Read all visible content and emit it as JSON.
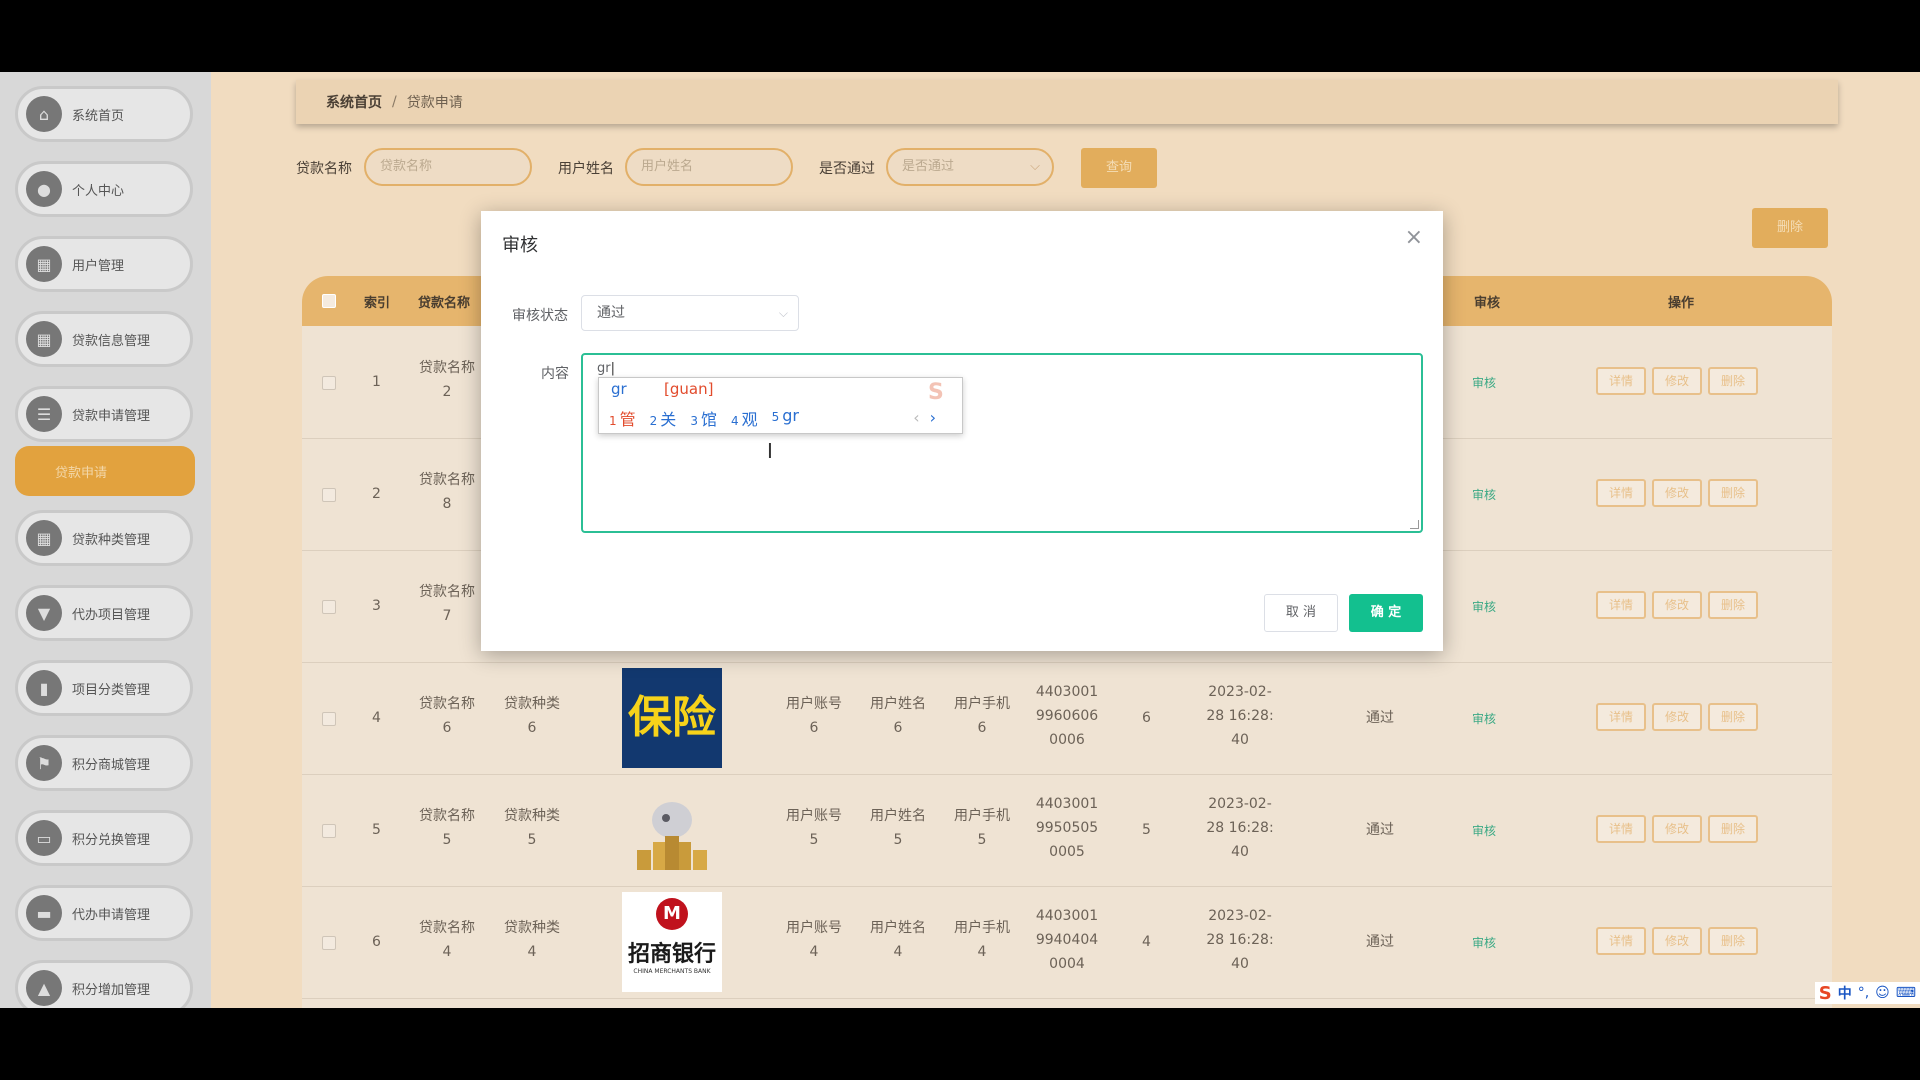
{
  "sidebar": {
    "items": [
      {
        "label": "系统首页",
        "icon": "home-icon"
      },
      {
        "label": "个人中心",
        "icon": "user-icon"
      },
      {
        "label": "用户管理",
        "icon": "grid-icon"
      },
      {
        "label": "贷款信息管理",
        "icon": "grid-icon"
      },
      {
        "label": "贷款申请管理",
        "icon": "list-icon"
      },
      {
        "label": "贷款申请",
        "active": true
      },
      {
        "label": "贷款种类管理",
        "icon": "grid-icon"
      },
      {
        "label": "代办项目管理",
        "icon": "filter-icon"
      },
      {
        "label": "项目分类管理",
        "icon": "chart-icon"
      },
      {
        "label": "积分商城管理",
        "icon": "flag-icon"
      },
      {
        "label": "积分兑换管理",
        "icon": "monitor-icon"
      },
      {
        "label": "代办申请管理",
        "icon": "ticket-icon"
      },
      {
        "label": "积分增加管理",
        "icon": "cake-icon"
      }
    ]
  },
  "breadcrumb": {
    "home": "系统首页",
    "sep": "/",
    "current": "贷款申请"
  },
  "search": {
    "loan_name_label": "贷款名称",
    "loan_name_placeholder": "贷款名称",
    "user_name_label": "用户姓名",
    "user_name_placeholder": "用户姓名",
    "passed_label": "是否通过",
    "passed_placeholder": "是否通过",
    "query_btn": "查询"
  },
  "delete_btn": "删除",
  "table": {
    "headers": [
      "索引",
      "贷款名称",
      "审核",
      "操作"
    ],
    "rows": [
      {
        "index": "1",
        "loan_name": [
          "贷款名称",
          "2"
        ]
      },
      {
        "index": "2",
        "loan_name": [
          "贷款名称",
          "8"
        ]
      },
      {
        "index": "3",
        "loan_name": [
          "贷款名称",
          "7"
        ]
      },
      {
        "index": "4",
        "loan_name": [
          "贷款名称",
          "6"
        ],
        "loan_type": [
          "贷款种类",
          "6"
        ],
        "account": [
          "用户账号",
          "6"
        ],
        "username": [
          "用户姓名",
          "6"
        ],
        "phone": [
          "用户手机",
          "6"
        ],
        "id": [
          "4403001",
          "9960606",
          "0006"
        ],
        "amount": "6",
        "time": [
          "2023-02-",
          "28 16:28:",
          "40"
        ],
        "passed": "通过",
        "picture": "保险"
      },
      {
        "index": "5",
        "loan_name": [
          "贷款名称",
          "5"
        ],
        "loan_type": [
          "贷款种类",
          "5"
        ],
        "account": [
          "用户账号",
          "5"
        ],
        "username": [
          "用户姓名",
          "5"
        ],
        "phone": [
          "用户手机",
          "5"
        ],
        "id": [
          "4403001",
          "9950505",
          "0005"
        ],
        "amount": "5",
        "time": [
          "2023-02-",
          "28 16:28:",
          "40"
        ],
        "passed": "通过"
      },
      {
        "index": "6",
        "loan_name": [
          "贷款名称",
          "4"
        ],
        "loan_type": [
          "贷款种类",
          "4"
        ],
        "account": [
          "用户账号",
          "4"
        ],
        "username": [
          "用户姓名",
          "4"
        ],
        "phone": [
          "用户手机",
          "4"
        ],
        "id": [
          "4403001",
          "9940404",
          "0004"
        ],
        "amount": "4",
        "time": [
          "2023-02-",
          "28 16:28:",
          "40"
        ],
        "passed": "通过",
        "picture_text": "招商银行",
        "picture_sub": "CHINA MERCHANTS BANK"
      }
    ],
    "review_link": "审核",
    "ops": [
      "详情",
      "修改",
      "删除"
    ]
  },
  "modal": {
    "title": "审核",
    "status_label": "审核状态",
    "status_value": "通过",
    "content_label": "内容",
    "content_value": "gr",
    "cancel": "取 消",
    "ok": "确 定"
  },
  "ime": {
    "code": "gr",
    "pinyin": "[guan]",
    "candidates": [
      {
        "n": "1",
        "t": "管"
      },
      {
        "n": "2",
        "t": "关"
      },
      {
        "n": "3",
        "t": "馆"
      },
      {
        "n": "4",
        "t": "观"
      },
      {
        "n": "5",
        "t": "gr"
      }
    ],
    "prev": "‹",
    "next": "›"
  },
  "tray": {
    "logo": "S",
    "lang": "中",
    "punct": "°,",
    "emoji": "☺",
    "kb": "⌨"
  }
}
